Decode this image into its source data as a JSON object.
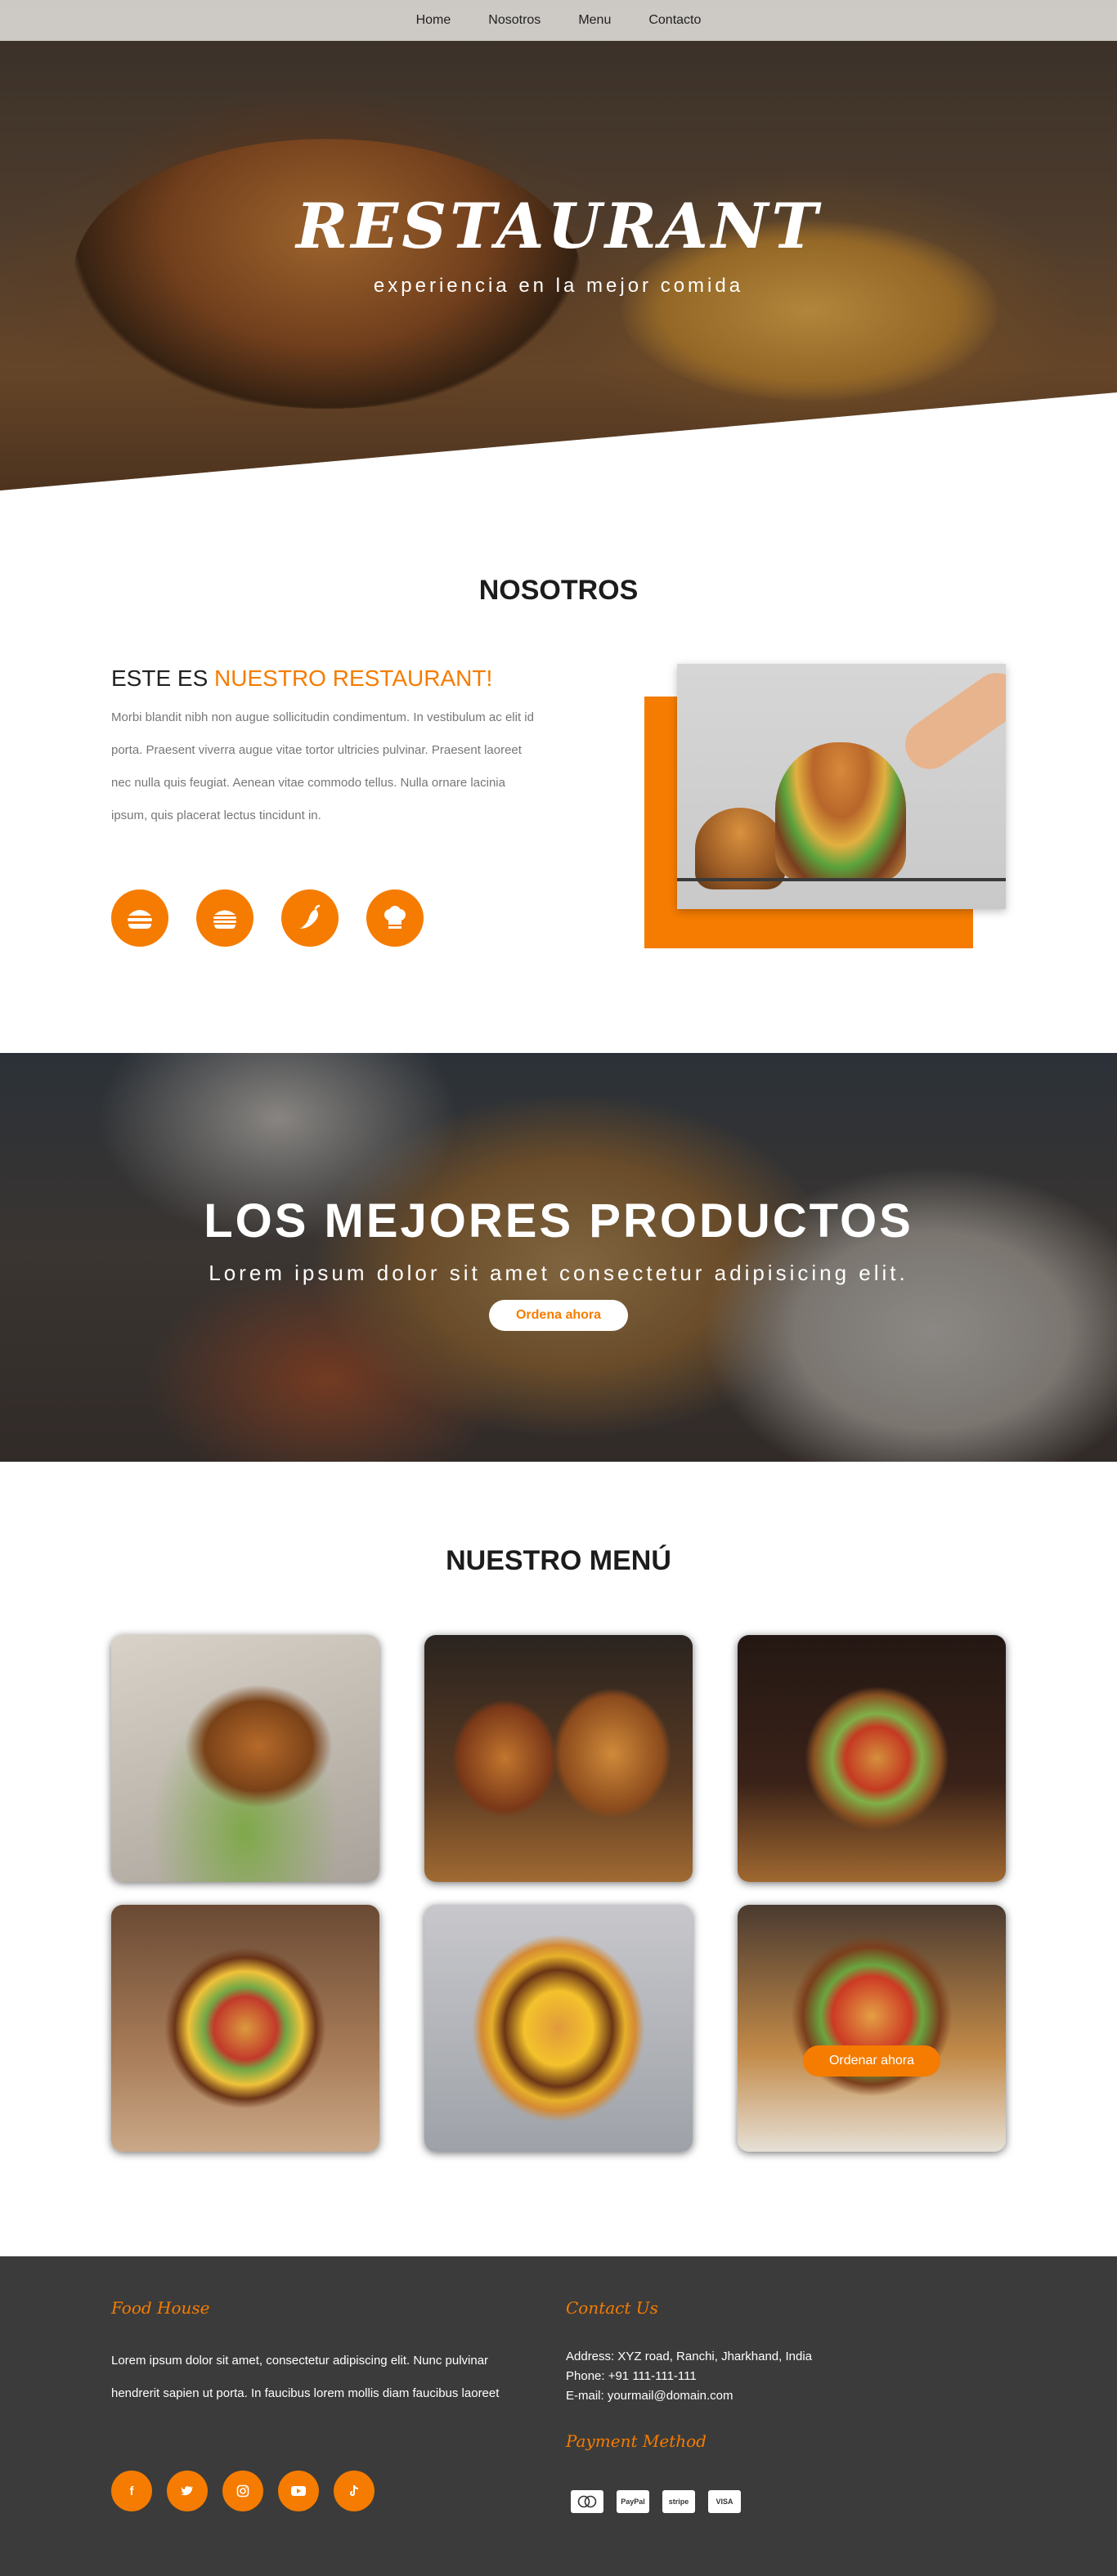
{
  "nav": {
    "items": [
      "Home",
      "Nosotros",
      "Menu",
      "Contacto"
    ]
  },
  "hero": {
    "title": "RESTAURANT",
    "subtitle": "experiencia en la mejor comida"
  },
  "about": {
    "section_title": "NOSOTROS",
    "heading_prefix": "ESTE ES ",
    "heading_accent": "NUESTRO RESTAURANT!",
    "text": "Morbi blandit nibh non augue sollicitudin condimentum. In vestibulum ac elit id porta. Praesent viverra augue vitae tortor ultricies pulvinar. Praesent laoreet nec nulla quis feugiat. Aenean vitae commodo tellus. Nulla ornare lacinia ipsum, quis placerat lectus tincidunt in.",
    "icons": [
      "burger-icon",
      "sandwich-icon",
      "chili-icon",
      "chef-hat-icon"
    ]
  },
  "banner": {
    "title": "LOS MEJORES PRODUCTOS",
    "tagline": "Lorem ipsum dolor sit amet consectetur adipisicing elit.",
    "button": "Ordena ahora"
  },
  "menu": {
    "section_title": "NUESTRO MENÚ",
    "hover_button": "Ordenar ahora"
  },
  "footer": {
    "brand_title": "Food House",
    "brand_text": "Lorem ipsum dolor sit amet, consectetur adipiscing elit. Nunc pulvinar hendrerit sapien ut porta. In faucibus lorem mollis diam faucibus laoreet",
    "contact_title": "Contact Us",
    "address": "Address: XYZ road, Ranchi, Jharkhand, India",
    "phone": "Phone: +91 111-111-111",
    "email": "E-mail: yourmail@domain.com",
    "payment_title": "Payment Method",
    "payment_methods": [
      "mastercard",
      "PayPal",
      "stripe",
      "VISA"
    ],
    "social_icons": [
      "facebook-icon",
      "twitter-icon",
      "instagram-icon",
      "youtube-icon",
      "tiktok-icon"
    ]
  },
  "colors": {
    "accent": "#f57c00",
    "footer_bg": "#3b3b3b"
  }
}
